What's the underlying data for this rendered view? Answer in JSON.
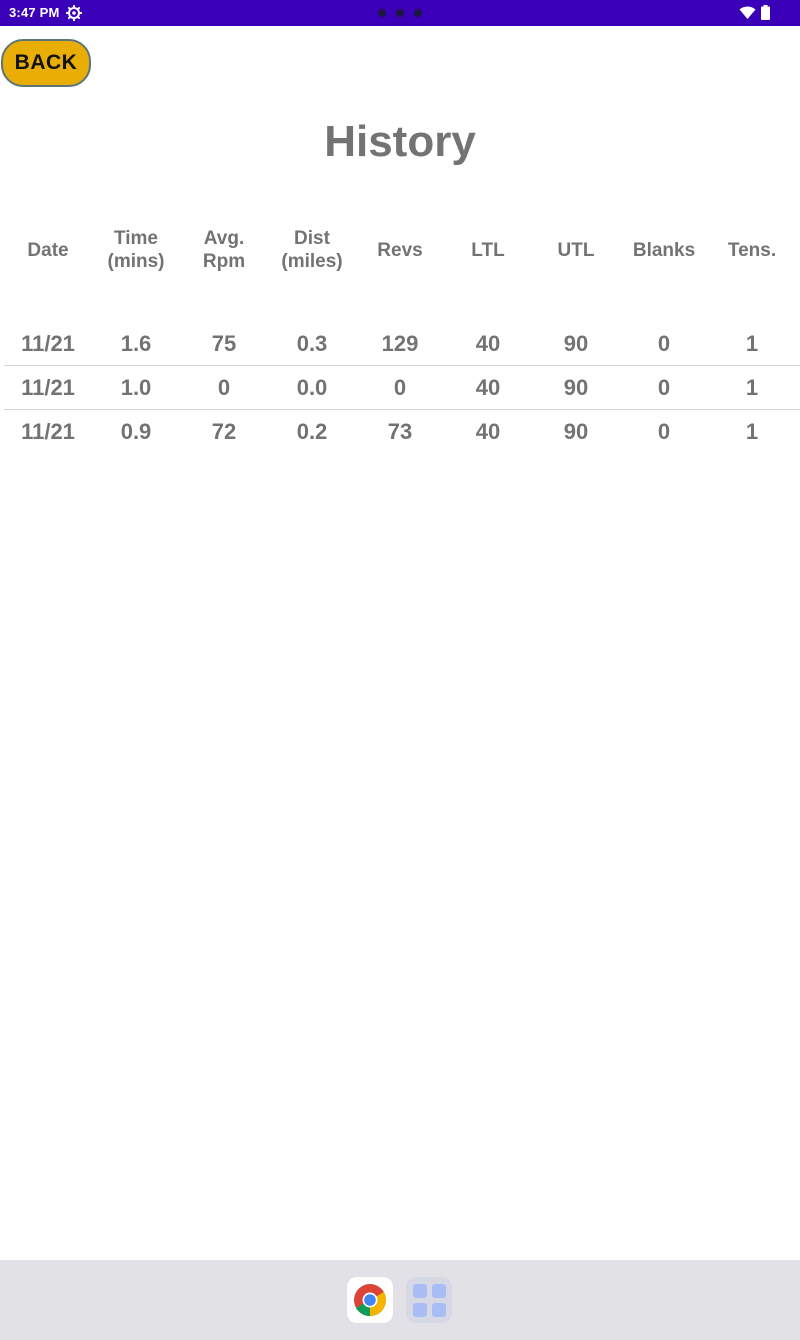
{
  "status_bar": {
    "time": "3:47 PM",
    "background": "#3a00b8",
    "icons": [
      "gear-icon",
      "more-dots-icon",
      "wifi-icon",
      "battery-icon"
    ]
  },
  "toolbar": {
    "back_label": "BACK",
    "back_color": "#e8ae06"
  },
  "page": {
    "title": "History"
  },
  "table": {
    "headers": [
      "Date",
      "Time\n(mins)",
      "Avg.\nRpm",
      "Dist\n(miles)",
      "Revs",
      "LTL",
      "UTL",
      "Blanks",
      "Tens."
    ],
    "rows": [
      [
        "11/21",
        "1.6",
        "75",
        "0.3",
        "129",
        "40",
        "90",
        "0",
        "1"
      ],
      [
        "11/21",
        "1.0",
        "0",
        "0.0",
        "0",
        "40",
        "90",
        "0",
        "1"
      ],
      [
        "11/21",
        "0.9",
        "72",
        "0.2",
        "73",
        "40",
        "90",
        "0",
        "1"
      ]
    ]
  },
  "dock": {
    "apps": [
      "chrome-icon",
      "app-drawer-icon"
    ]
  }
}
